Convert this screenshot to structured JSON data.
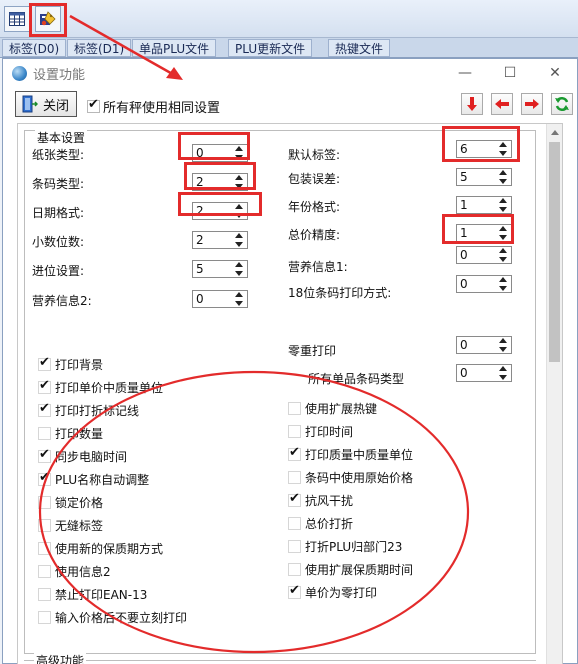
{
  "tabs": [
    "标签(D0)",
    "标签(D1)",
    "单品PLU文件",
    "PLU更新文件",
    "热键文件"
  ],
  "dialog": {
    "title": "设置功能",
    "close_label": "关闭",
    "same_settings_label": "所有秤使用相同设置",
    "same_settings_checked": true
  },
  "basic": {
    "group_title": "基本设置",
    "left_fields": [
      {
        "label": "纸张类型:",
        "value": "0"
      },
      {
        "label": "条码类型:",
        "value": "2"
      },
      {
        "label": "日期格式:",
        "value": "2"
      },
      {
        "label": "小数位数:",
        "value": "2"
      },
      {
        "label": "进位设置:",
        "value": "5"
      },
      {
        "label": "营养信息2:",
        "value": "0"
      }
    ],
    "right_fields": [
      {
        "label": "默认标签:",
        "value": "6"
      },
      {
        "label": "包装误差:",
        "value": "5"
      },
      {
        "label": "年份格式:",
        "value": "1"
      },
      {
        "label": "总价精度:",
        "value": "1"
      },
      {
        "label": "营养信息1:",
        "value": "0"
      },
      {
        "label": "18位条码打印方式:",
        "value": "0"
      }
    ],
    "zero_weight": {
      "label": "零重打印",
      "value": "0"
    },
    "all_plu_barcode": {
      "label": "所有单品条码类型",
      "value": "0"
    },
    "left_checks": [
      {
        "label": "打印背景",
        "checked": true
      },
      {
        "label": "打印单价中质量单位",
        "checked": true
      },
      {
        "label": "打印打折标记线",
        "checked": true
      },
      {
        "label": "打印数量",
        "checked": false
      },
      {
        "label": "同步电脑时间",
        "checked": true
      },
      {
        "label": "PLU名称自动调整",
        "checked": true
      },
      {
        "label": "锁定价格",
        "checked": false
      },
      {
        "label": "无缝标签",
        "checked": false
      },
      {
        "label": "使用新的保质期方式",
        "checked": false
      },
      {
        "label": "使用信息2",
        "checked": false
      },
      {
        "label": "禁止打印EAN-13",
        "checked": false
      },
      {
        "label": "输入价格后不要立刻打印",
        "checked": false
      }
    ],
    "right_checks": [
      {
        "label": "使用扩展热键",
        "checked": false
      },
      {
        "label": "打印时间",
        "checked": false
      },
      {
        "label": "打印质量中质量单位",
        "checked": true
      },
      {
        "label": "条码中使用原始价格",
        "checked": false
      },
      {
        "label": "抗风干扰",
        "checked": true
      },
      {
        "label": "总价打折",
        "checked": false
      },
      {
        "label": "打折PLU归部门23",
        "checked": false
      },
      {
        "label": "使用扩展保质期时间",
        "checked": false
      },
      {
        "label": "单价为零打印",
        "checked": true
      }
    ]
  },
  "advanced": {
    "group_title": "高级功能"
  },
  "colors": {
    "annotation": "#e32b2b"
  }
}
